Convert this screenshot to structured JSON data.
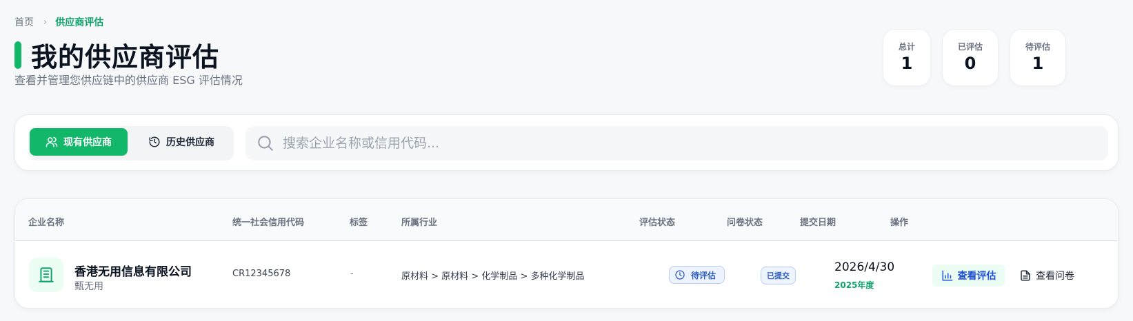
{
  "breadcrumb": {
    "home": "首页",
    "separator": "›",
    "current": "供应商评估"
  },
  "page": {
    "title": "我的供应商评估",
    "subtitle": "查看并管理您供应链中的供应商 ESG 评估情况"
  },
  "stats": [
    {
      "label": "总计",
      "value": "1"
    },
    {
      "label": "已评估",
      "value": "0"
    },
    {
      "label": "待评估",
      "value": "1"
    }
  ],
  "tabs": [
    {
      "label": "现有供应商",
      "icon": "users-icon",
      "active": true
    },
    {
      "label": "历史供应商",
      "icon": "history-icon",
      "active": false
    }
  ],
  "search": {
    "placeholder": "搜索企业名称或信用代码..."
  },
  "table": {
    "columns": [
      "企业名称",
      "统一社会信用代码",
      "标签",
      "所属行业",
      "评估状态",
      "问卷状态",
      "提交日期",
      "操作"
    ],
    "rows": [
      {
        "company_name": "香港无用信息有限公司",
        "company_sub": "甄无用",
        "credit_code": "CR12345678",
        "tag": "-",
        "industry": "原材料 > 原材料 > 化学制品 > 多种化学制品",
        "eval_status": "待评估",
        "questionnaire_status": "已提交",
        "submit_date": "2026/4/30",
        "submit_year": "2025年度",
        "action_view_eval": "查看评估",
        "action_view_questionnaire": "查看问卷"
      }
    ]
  },
  "colors": {
    "accent": "#12b76a",
    "link": "#1d4ed8",
    "badge_blue": "#2f5ec4"
  }
}
